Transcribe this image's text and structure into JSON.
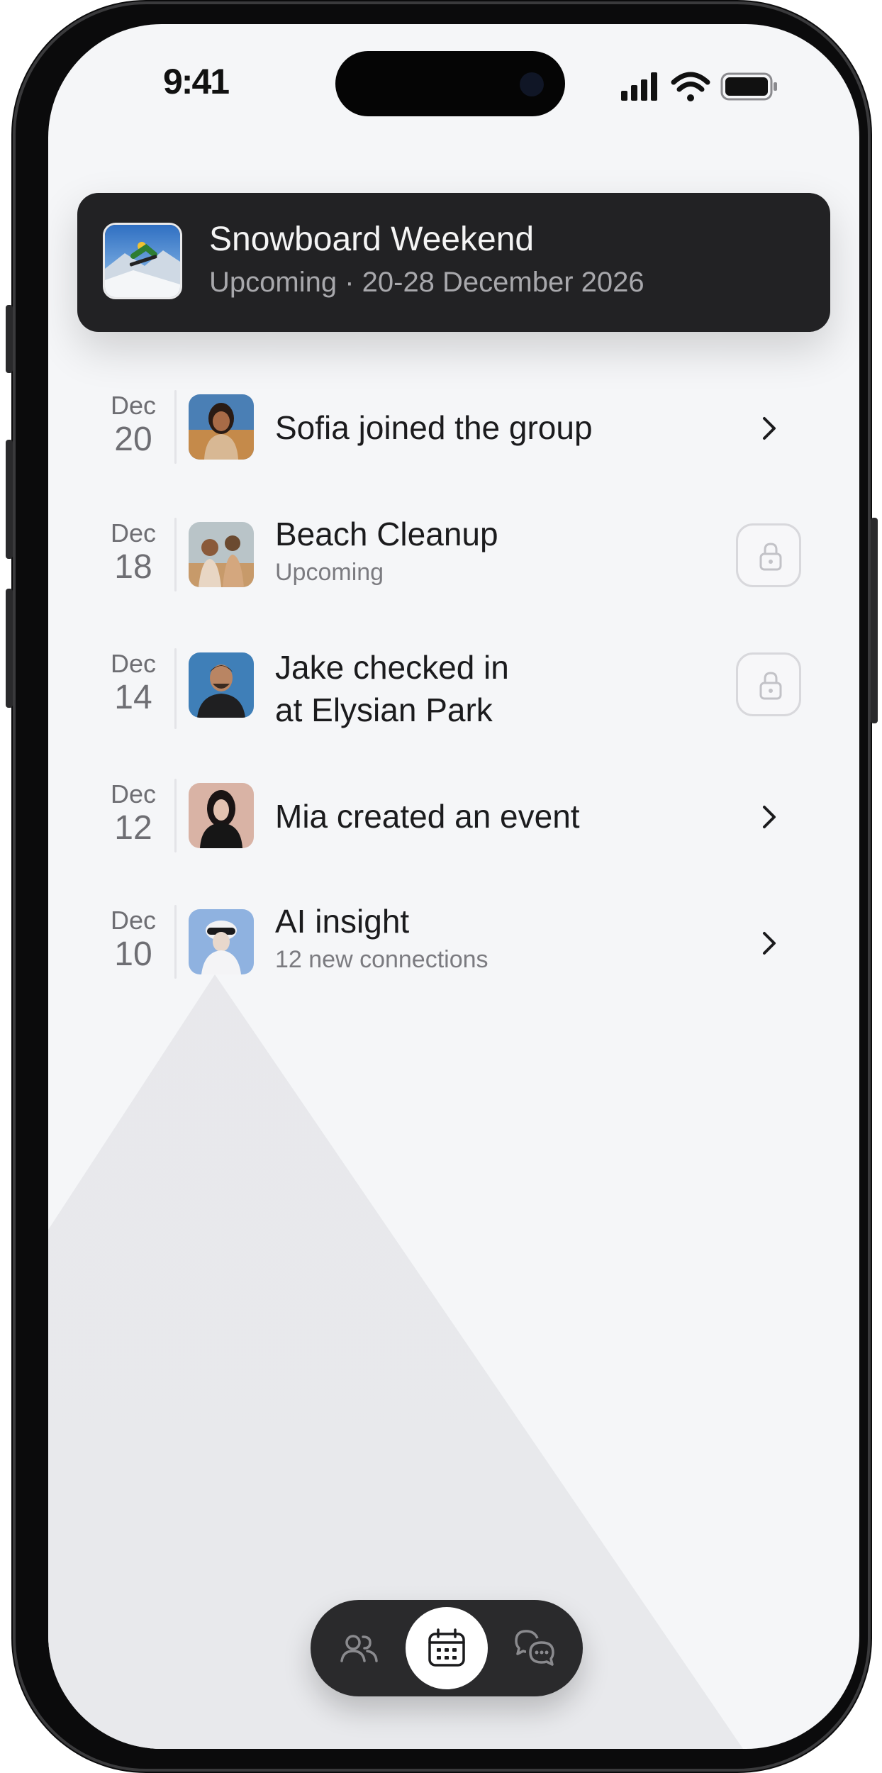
{
  "status_bar": {
    "time": "9:41"
  },
  "header_card": {
    "title": "Snowboard Weekend",
    "subtitle": "Upcoming · 20-28 December 2026",
    "thumbnail": "snowboarder-photo"
  },
  "feed": [
    {
      "month": "Dec",
      "day": "20",
      "title": "Sofia joined the group",
      "subtitle": "",
      "action": "chevron-right-icon"
    },
    {
      "month": "Dec",
      "day": "18",
      "title": "Beach Cleanup",
      "subtitle": "Upcoming",
      "action": "lock-icon"
    },
    {
      "month": "Dec",
      "day": "14",
      "title": "Jake checked in",
      "title_line2": "at Elysian Park",
      "subtitle": "",
      "action": "lock-icon"
    },
    {
      "month": "Dec",
      "day": "12",
      "title": "Mia created an event",
      "subtitle": "",
      "action": "chevron-right-icon"
    },
    {
      "month": "Dec",
      "day": "10",
      "title": "AI insight",
      "subtitle": "12 new connections",
      "action": "chevron-right-icon"
    }
  ],
  "tab_bar": {
    "tabs": [
      {
        "icon": "people-icon",
        "active": false
      },
      {
        "icon": "calendar-icon",
        "active": true
      },
      {
        "icon": "chat-icon",
        "active": false
      }
    ]
  },
  "colors": {
    "screen_bg": "#f5f6f8",
    "card_bg": "#222224",
    "tabbar_bg": "#2a2a2c",
    "text_primary": "#1b1b1d",
    "text_secondary": "#7b7b80"
  }
}
